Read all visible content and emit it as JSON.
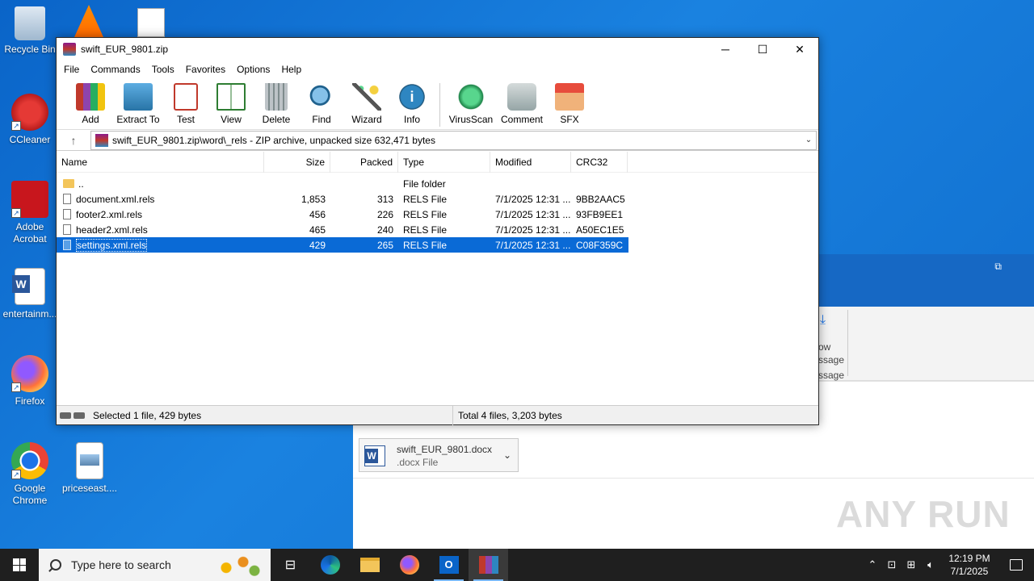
{
  "desktop": {
    "icons": [
      {
        "label": "Recycle Bin"
      },
      {
        "label": "CCleaner"
      },
      {
        "label": "Adobe Acrobat"
      },
      {
        "label": "entertainm..."
      },
      {
        "label": "Firefox"
      },
      {
        "label": "Google Chrome"
      },
      {
        "label": "priceseast...."
      }
    ]
  },
  "background_app": {
    "ribbon_text_1": "ow",
    "ribbon_text_2": "ssage",
    "ribbon_text_3": "ssage",
    "attachment_name": "swift_EUR_9801.docx",
    "attachment_type": ".docx File",
    "watermark": "ANY RUN"
  },
  "window": {
    "title": "swift_EUR_9801.zip",
    "menu": [
      "File",
      "Commands",
      "Tools",
      "Favorites",
      "Options",
      "Help"
    ],
    "toolbar": [
      {
        "label": "Add",
        "icon": "add-archive-icon"
      },
      {
        "label": "Extract To",
        "icon": "extract-folder-icon"
      },
      {
        "label": "Test",
        "icon": "test-clipboard-icon"
      },
      {
        "label": "View",
        "icon": "view-book-icon"
      },
      {
        "label": "Delete",
        "icon": "trash-icon"
      },
      {
        "label": "Find",
        "icon": "magnifier-icon"
      },
      {
        "label": "Wizard",
        "icon": "wand-icon"
      },
      {
        "label": "Info",
        "icon": "info-icon"
      },
      {
        "label": "VirusScan",
        "icon": "virus-icon"
      },
      {
        "label": "Comment",
        "icon": "comment-icon"
      },
      {
        "label": "SFX",
        "icon": "sfx-box-icon"
      }
    ],
    "address": "swift_EUR_9801.zip\\word\\_rels - ZIP archive, unpacked size 632,471 bytes",
    "columns": [
      "Name",
      "Size",
      "Packed",
      "Type",
      "Modified",
      "CRC32"
    ],
    "files": [
      {
        "name": "..",
        "size": "",
        "packed": "",
        "type": "File folder",
        "modified": "",
        "crc": "",
        "kind": "folder"
      },
      {
        "name": "document.xml.rels",
        "size": "1,853",
        "packed": "313",
        "type": "RELS File",
        "modified": "7/1/2025 12:31 ...",
        "crc": "9BB2AAC5",
        "kind": "file"
      },
      {
        "name": "footer2.xml.rels",
        "size": "456",
        "packed": "226",
        "type": "RELS File",
        "modified": "7/1/2025 12:31 ...",
        "crc": "93FB9EE1",
        "kind": "file"
      },
      {
        "name": "header2.xml.rels",
        "size": "465",
        "packed": "240",
        "type": "RELS File",
        "modified": "7/1/2025 12:31 ...",
        "crc": "A50EC1E5",
        "kind": "file"
      },
      {
        "name": "settings.xml.rels",
        "size": "429",
        "packed": "265",
        "type": "RELS File",
        "modified": "7/1/2025 12:31 ...",
        "crc": "C08F359C",
        "kind": "file",
        "selected": true
      }
    ],
    "status_left": "Selected 1 file, 429 bytes",
    "status_right": "Total 4 files, 3,203 bytes"
  },
  "taskbar": {
    "search_placeholder": "Type here to search",
    "time": "12:19 PM",
    "date": "7/1/2025"
  }
}
